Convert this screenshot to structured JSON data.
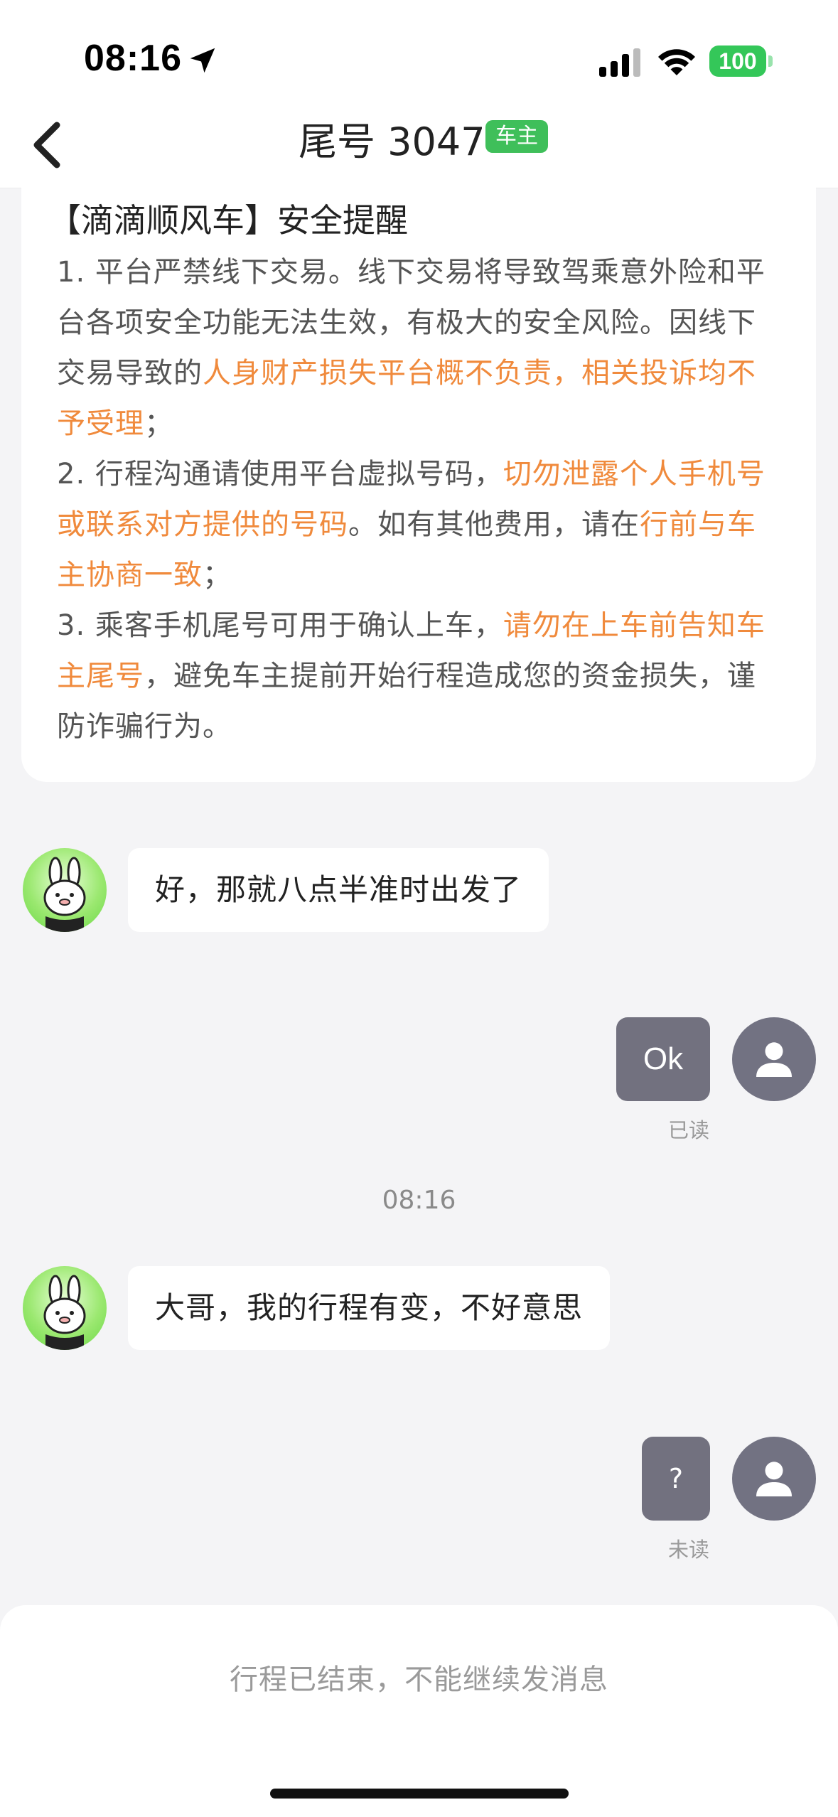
{
  "status_bar": {
    "time": "08:16",
    "battery": "100"
  },
  "nav": {
    "title": "尾号 3047",
    "badge": "车主"
  },
  "safety": {
    "title": "【滴滴顺风车】安全提醒",
    "lines": [
      [
        {
          "t": "1. 平台严禁线下交易。线下交易将导致驾乘意外险和平",
          "hl": false
        }
      ],
      [
        {
          "t": "台各项安全功能无法生效，有极大的安全风险。因线下",
          "hl": false
        }
      ],
      [
        {
          "t": "交易导致的",
          "hl": false
        },
        {
          "t": "人身财产损失平台概不负责，相关投诉均不",
          "hl": true
        }
      ],
      [
        {
          "t": "予受理",
          "hl": true
        },
        {
          "t": "；",
          "hl": false
        }
      ],
      [
        {
          "t": "2. 行程沟通请使用平台虚拟号码，",
          "hl": false
        },
        {
          "t": "切勿泄露个人手机号",
          "hl": true
        }
      ],
      [
        {
          "t": "或联系对方提供的号码",
          "hl": true
        },
        {
          "t": "。如有其他费用，请在",
          "hl": false
        },
        {
          "t": "行前与车",
          "hl": true
        }
      ],
      [
        {
          "t": "主协商一致",
          "hl": true
        },
        {
          "t": "；",
          "hl": false
        }
      ],
      [
        {
          "t": "3. 乘客手机尾号可用于确认上车，",
          "hl": false
        },
        {
          "t": "请勿在上车前告知车",
          "hl": true
        }
      ],
      [
        {
          "t": "主尾号",
          "hl": true
        },
        {
          "t": "，避免车主提前开始行程造成您的资金损失，谨",
          "hl": false
        }
      ],
      [
        {
          "t": "防诈骗行为。",
          "hl": false
        }
      ]
    ]
  },
  "messages": {
    "m1": "好，那就八点半准时出发了",
    "m2": "Ok",
    "m2_status": "已读",
    "separator_time": "08:16",
    "m3": "大哥，我的行程有变，不好意思",
    "m4": "?",
    "m4_status": "未读"
  },
  "footer": {
    "notice": "行程已结束，不能继续发消息"
  },
  "colors": {
    "highlight": "#f08a3c",
    "badge": "#3fbf5a",
    "outgoing_bubble": "#72717f"
  }
}
